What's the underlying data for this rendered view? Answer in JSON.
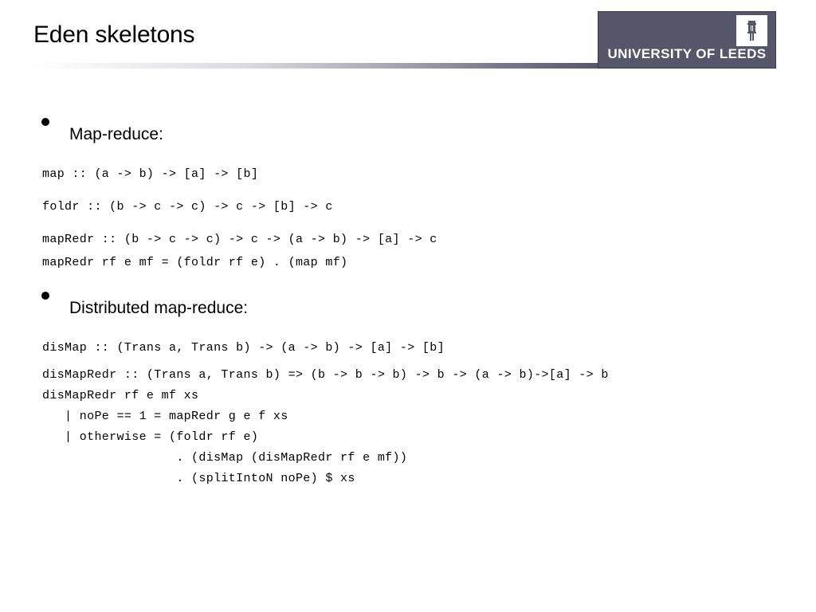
{
  "header": {
    "title": "Eden skeletons",
    "logo": {
      "wordmark": "UNIVERSITY OF LEEDS",
      "crest_icon": "leeds-tower-crest-icon",
      "box_color": "#56566a",
      "text_color": "#ffffff"
    },
    "rule": {
      "gradient_from": "#ffffff",
      "gradient_to": "#56566a"
    }
  },
  "body": {
    "bullets": [
      {
        "label": "Map-reduce:"
      },
      {
        "label": "Distributed map-reduce:"
      }
    ],
    "code_blocks": [
      {
        "lines": [
          "map :: (a -> b) -> [a] -> [b]",
          "foldr :: (b -> c -> c) -> c -> [b] -> c",
          "mapRedr :: (b -> c -> c) -> c -> (a -> b) -> [a] -> c",
          "mapRedr rf e mf = (foldr rf e) . (map mf)"
        ]
      },
      {
        "lines": [
          "disMap :: (Trans a, Trans b) -> (a -> b) -> [a] -> [b]",
          "disMapRedr :: (Trans a, Trans b) => (b -> b -> b) -> b -> (a -> b)->[a] -> b",
          "disMapRedr rf e mf xs",
          "   | noPe == 1 = mapRedr g e f xs",
          "   | otherwise = (foldr rf e)",
          "                  . (disMap (disMapRedr rf e mf))",
          "                  . (splitIntoN noPe) $ xs"
        ]
      }
    ]
  }
}
